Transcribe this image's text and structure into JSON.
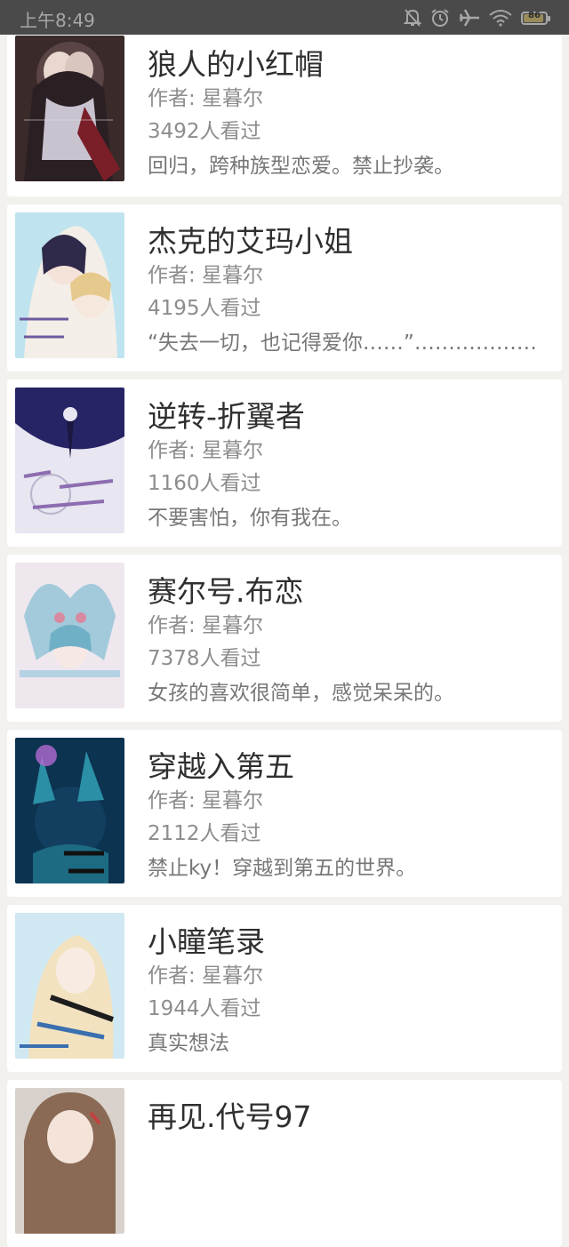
{
  "status_bar": {
    "time": "上午8:49",
    "battery_level": "86",
    "icons": [
      "bell-off-icon",
      "alarm-icon",
      "airplane-icon",
      "wifi-icon",
      "battery-icon"
    ]
  },
  "books": [
    {
      "title": "狼人的小红帽",
      "author": "作者: 星暮尔",
      "views": "3492人看过",
      "desc": "回归，跨种族型恋爱。禁止抄袭。",
      "cover_colors": [
        "#3a2a2a",
        "#c9c2cf",
        "#7a1e28"
      ]
    },
    {
      "title": "杰克的艾玛小姐",
      "author": "作者: 星暮尔",
      "views": "4195人看过",
      "desc": "“失去一切，也记得爱你……”………………………",
      "cover_colors": [
        "#bfe4ef",
        "#f3efe8",
        "#6e5a9e"
      ]
    },
    {
      "title": "逆转-折翼者",
      "author": "作者: 星暮尔",
      "views": "1160人看过",
      "desc": "不要害怕，你有我在。",
      "cover_colors": [
        "#e7e6f1",
        "#272466",
        "#8d6cb0"
      ]
    },
    {
      "title": "赛尔号.布恋",
      "author": "作者: 星暮尔",
      "views": "7378人看过",
      "desc": "女孩的喜欢很简单，感觉呆呆的。",
      "cover_colors": [
        "#efe7ee",
        "#8fc3d6",
        "#d88aa0"
      ]
    },
    {
      "title": "穿越入第五",
      "author": "作者: 星暮尔",
      "views": "2112人看过",
      "desc": "禁止ky！穿越到第五的世界。",
      "cover_colors": [
        "#0c3350",
        "#2b8fa6",
        "#b26ad2"
      ]
    },
    {
      "title": "小瞳笔录",
      "author": "作者: 星暮尔",
      "views": "1944人看过",
      "desc": "真实想法",
      "cover_colors": [
        "#cfe8f2",
        "#f2e2bf",
        "#3a6fb0"
      ]
    },
    {
      "title": "再见.代号97",
      "author": "",
      "views": "",
      "desc": "",
      "cover_colors": [
        "#d9d2cc",
        "#8a6a55",
        "#c44040"
      ]
    }
  ]
}
